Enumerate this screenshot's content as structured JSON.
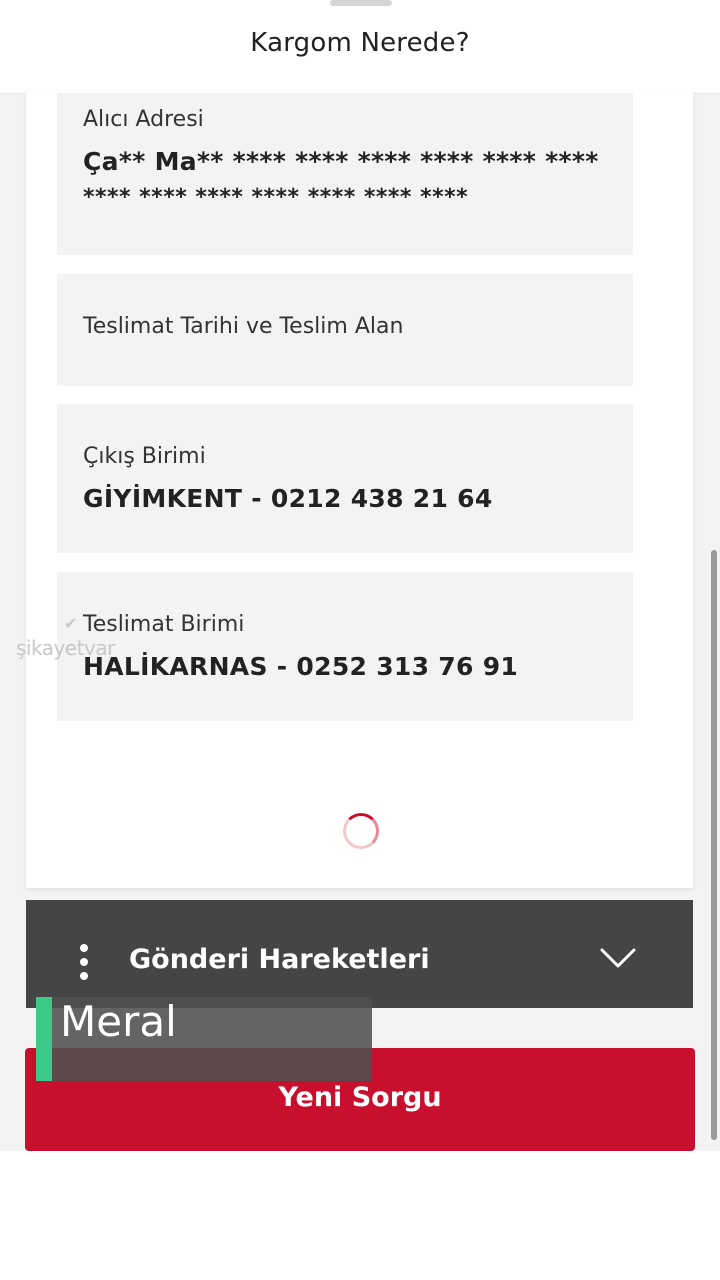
{
  "header": {
    "title": "Kargom Nerede?"
  },
  "details": {
    "recipient_address": {
      "label": "Alıcı Adresi",
      "value_line1": "Ça** Ma** **** **** **** **** **** ****",
      "value_line2": "**** **** **** **** **** **** ****"
    },
    "delivery_date": {
      "label": "Teslimat Tarihi ve Teslim Alan"
    },
    "departure_unit": {
      "label": "Çıkış Birimi",
      "value": "GİYİMKENT - 0212 438 21 64"
    },
    "delivery_unit": {
      "label": "Teslimat Birimi",
      "value": "HALİKARNAS - 0252 313 76 91"
    }
  },
  "watermark": {
    "text": "şikayetvar"
  },
  "movements": {
    "title": "Gönderi Hareketleri",
    "menu_icon": "vertical-dots-icon",
    "toggle_icon": "chevron-down-icon"
  },
  "actions": {
    "new_query_label": "Yeni Sorgu"
  },
  "caption": {
    "text": "Meral"
  },
  "colors": {
    "brand_red": "#c8102e",
    "bar_dark": "#454545",
    "caption_accent": "#3cc98a"
  }
}
